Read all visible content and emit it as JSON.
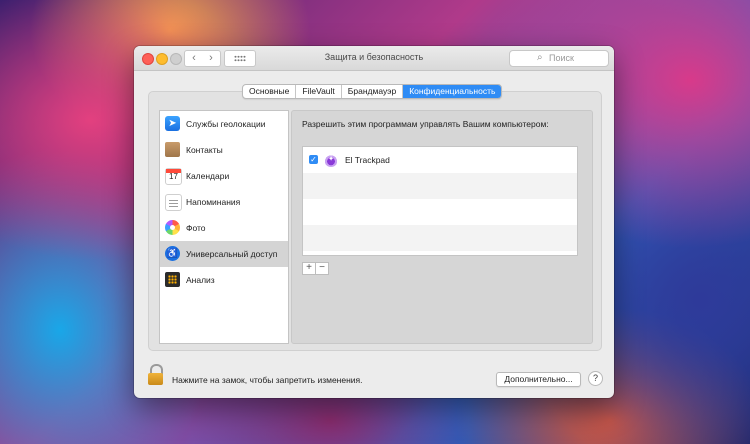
{
  "window": {
    "title": "Защита и безопасность"
  },
  "toolbar": {
    "back_icon": "chevron-left-icon",
    "forward_icon": "chevron-right-icon",
    "grid_icon": "grid-icon",
    "search_placeholder": "Поиск"
  },
  "tabs": [
    {
      "label": "Основные",
      "active": false
    },
    {
      "label": "FileVault",
      "active": false
    },
    {
      "label": "Брандмауэр",
      "active": false
    },
    {
      "label": "Конфиденциальность",
      "active": true
    }
  ],
  "sidebar": {
    "items": [
      {
        "label": "Службы геолокации",
        "icon": "location-arrow-icon",
        "selected": false
      },
      {
        "label": "Контакты",
        "icon": "contacts-book-icon",
        "selected": false
      },
      {
        "label": "Календари",
        "icon": "calendar-icon",
        "icon_text": "17",
        "selected": false
      },
      {
        "label": "Напоминания",
        "icon": "reminders-list-icon",
        "selected": false
      },
      {
        "label": "Фото",
        "icon": "photos-flower-icon",
        "selected": false
      },
      {
        "label": "Универсальный доступ",
        "icon": "accessibility-icon",
        "selected": true
      },
      {
        "label": "Анализ",
        "icon": "analytics-icon",
        "selected": false
      }
    ]
  },
  "pane": {
    "heading": "Разрешить этим программам управлять Вашим компьютером:",
    "apps": [
      {
        "name": "El Trackpad",
        "checked": true,
        "icon": "el-trackpad-app-icon"
      }
    ],
    "add_label": "+",
    "remove_label": "−"
  },
  "footer": {
    "lock_text": "Нажмите на замок, чтобы запретить изменения.",
    "advanced_label": "Дополнительно...",
    "help_label": "?"
  },
  "colors": {
    "accent": "#2f8cf5",
    "close": "#fe5f57",
    "minimize": "#febc2e"
  }
}
